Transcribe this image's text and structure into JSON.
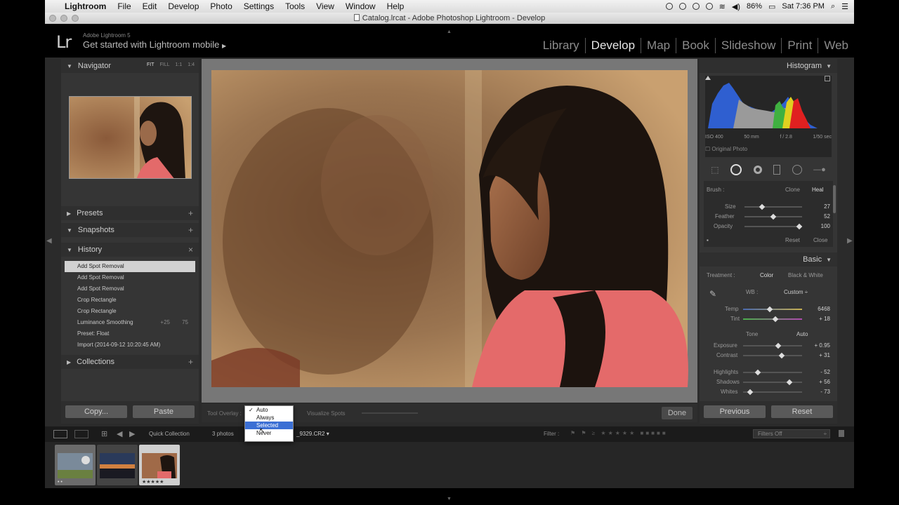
{
  "menubar": {
    "app": "Lightroom",
    "items": [
      "File",
      "Edit",
      "Develop",
      "Photo",
      "Settings",
      "Tools",
      "View",
      "Window",
      "Help"
    ],
    "battery": "86%",
    "clock": "Sat 7:36 PM"
  },
  "window": {
    "title": "Catalog.lrcat - Adobe Photoshop Lightroom - Develop"
  },
  "identity": {
    "logo": "Lr",
    "product": "Adobe Lightroom 5",
    "tagline": "Get started with Lightroom mobile",
    "modules": [
      "Library",
      "Develop",
      "Map",
      "Book",
      "Slideshow",
      "Print",
      "Web"
    ],
    "active_module": "Develop"
  },
  "left_panel": {
    "navigator": {
      "title": "Navigator",
      "zoom": [
        "FIT",
        "FILL",
        "1:1",
        "1:4"
      ]
    },
    "presets": "Presets",
    "snapshots": "Snapshots",
    "history": {
      "title": "History",
      "close": "×",
      "items": [
        {
          "label": "Add Spot Removal",
          "selected": true,
          "before": "",
          "after": ""
        },
        {
          "label": "Add Spot Removal",
          "selected": false,
          "before": "",
          "after": ""
        },
        {
          "label": "Add Spot Removal",
          "selected": false,
          "before": "",
          "after": ""
        },
        {
          "label": "Crop Rectangle",
          "selected": false,
          "before": "",
          "after": ""
        },
        {
          "label": "Crop Rectangle",
          "selected": false,
          "before": "",
          "after": ""
        },
        {
          "label": "Luminance Smoothing",
          "selected": false,
          "before": "+25",
          "after": "75"
        },
        {
          "label": "Preset: Float",
          "selected": false,
          "before": "",
          "after": ""
        },
        {
          "label": "Import (2014-09-12 10:20:45 AM)",
          "selected": false,
          "before": "",
          "after": ""
        }
      ]
    },
    "collections": "Collections",
    "copy_button": "Copy...",
    "paste_button": "Paste"
  },
  "toolbar": {
    "tool_overlay_label": "Tool Overlay :",
    "visualize_spots": "Visualize Spots",
    "done": "Done",
    "dropdown": {
      "options": [
        "Auto",
        "Always",
        "Selected",
        "Never"
      ],
      "checked": "Auto",
      "highlighted": "Selected"
    }
  },
  "right_panel": {
    "histogram": {
      "title": "Histogram",
      "info": [
        "ISO 400",
        "50 mm",
        "f / 2.8",
        "1/50 sec"
      ],
      "original_photo": "Original Photo"
    },
    "spot_removal": {
      "brush": "Brush :",
      "clone": "Clone",
      "heal": "Heal",
      "sliders": [
        {
          "label": "Size",
          "value": "27",
          "pos": 0.3
        },
        {
          "label": "Feather",
          "value": "52",
          "pos": 0.5
        },
        {
          "label": "Opacity",
          "value": "100",
          "pos": 0.95
        }
      ],
      "reset": "Reset",
      "close": "Close"
    },
    "basic": {
      "title": "Basic",
      "treatment_label": "Treatment :",
      "color": "Color",
      "bw": "Black & White",
      "wb_label": "WB :",
      "wb_value": "Custom ÷",
      "temp": {
        "label": "Temp",
        "value": "6468",
        "pos": 0.45
      },
      "tint": {
        "label": "Tint",
        "value": "+ 18",
        "pos": 0.55
      },
      "tone_label": "Tone",
      "auto": "Auto",
      "tone_sliders": [
        {
          "label": "Exposure",
          "value": "+ 0.95",
          "pos": 0.6
        },
        {
          "label": "Contrast",
          "value": "+ 31",
          "pos": 0.65
        }
      ],
      "tone_sliders2": [
        {
          "label": "Highlights",
          "value": "- 52",
          "pos": 0.25
        },
        {
          "label": "Shadows",
          "value": "+ 56",
          "pos": 0.78
        },
        {
          "label": "Whites",
          "value": "- 73",
          "pos": 0.12
        }
      ]
    },
    "previous": "Previous",
    "reset": "Reset"
  },
  "filmstrip": {
    "quick_collection": "Quick Collection",
    "photos": "3 photos",
    "filename": "_9329.CR2 ▾",
    "filter_label": "Filter :",
    "filters_off": "Filters Off",
    "thumbs": [
      {
        "name": "thumb-1",
        "stars": "• •",
        "selected": false
      },
      {
        "name": "thumb-2",
        "stars": "",
        "selected": false
      },
      {
        "name": "thumb-3",
        "stars": "★★★★★",
        "selected": true
      }
    ]
  }
}
